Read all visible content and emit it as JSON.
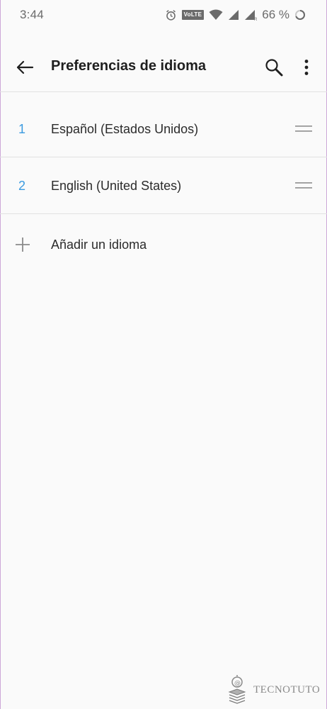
{
  "status_bar": {
    "time": "3:44",
    "volte": "VoLTE",
    "battery": "66 %"
  },
  "app_bar": {
    "title": "Preferencias de idioma"
  },
  "languages": [
    {
      "number": "1",
      "label": "Español (Estados Unidos)"
    },
    {
      "number": "2",
      "label": "English (United States)"
    }
  ],
  "add_language": {
    "label": "Añadir un idioma"
  },
  "watermark": {
    "text": "TECNOTUTO"
  },
  "icons": {
    "back": "arrow-back-icon",
    "search": "search-icon",
    "more": "more-vert-icon",
    "drag": "drag-handle-icon",
    "add": "plus-icon",
    "alarm": "alarm-icon",
    "wifi": "wifi-icon",
    "signal": "signal-icon",
    "battery": "battery-icon"
  },
  "colors": {
    "background": "#fafafa",
    "accent_number": "#3c9be0",
    "divider": "#e2e2e2",
    "text_primary": "#2b2b2b"
  }
}
